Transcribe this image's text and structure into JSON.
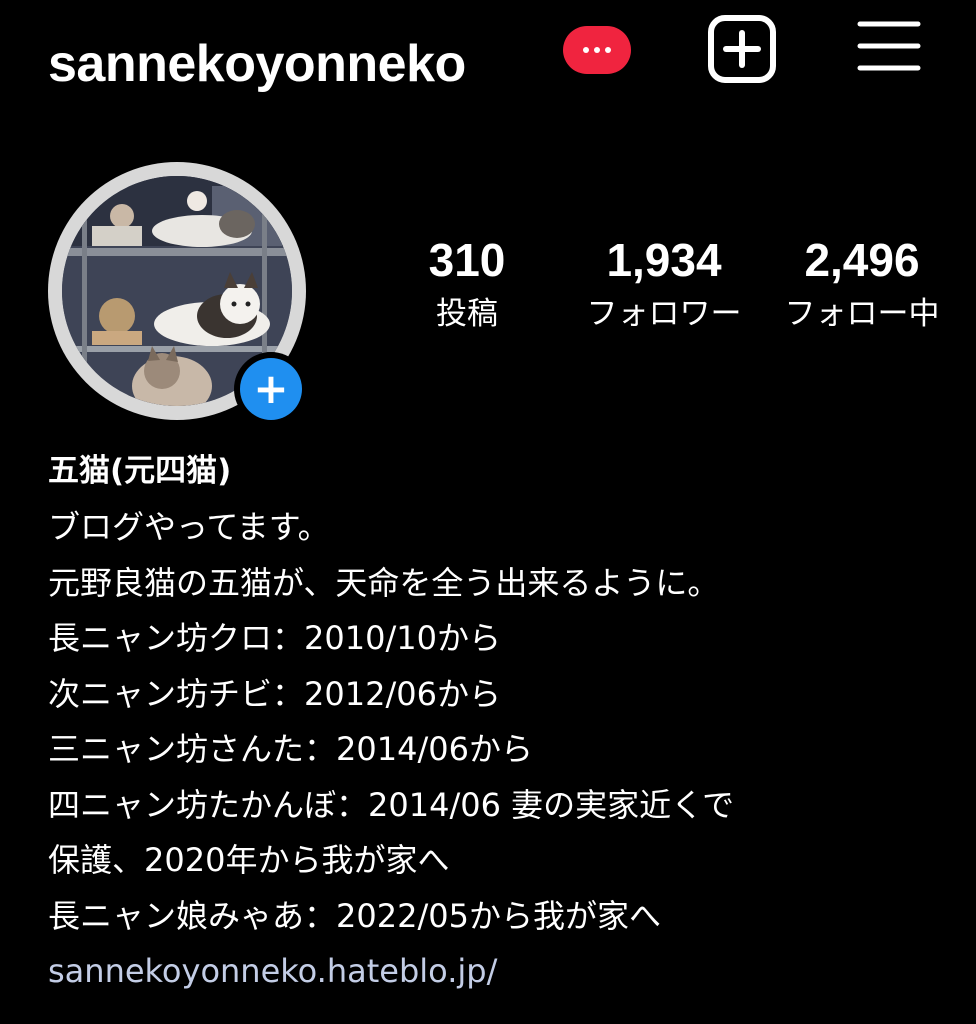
{
  "header": {
    "username": "sannekoyonneko",
    "badge_icon": "more-dots-icon",
    "accent_badge_color": "#f0243f"
  },
  "profile": {
    "avatar_alt": "profile-photo",
    "add_story_symbol": "+",
    "stats": [
      {
        "value": "310",
        "label": "投稿"
      },
      {
        "value": "1,934",
        "label": "フォロワー"
      },
      {
        "value": "2,496",
        "label": "フォロー中"
      }
    ]
  },
  "bio": {
    "name": "五猫(元四猫)",
    "lines": [
      "ブログやってます。",
      "元野良猫の五猫が、天命を全う出来るように。",
      "長ニャン坊クロ：2010/10から",
      "次ニャン坊チビ：2012/06から",
      "三ニャン坊さんた：2014/06から",
      "四ニャン坊たかんぼ：2014/06 妻の実家近くで",
      "保護、2020年から我が家へ",
      "長ニャン娘みゃあ：2022/05から我が家へ"
    ],
    "link": "sannekoyonneko.hateblo.jp/"
  }
}
